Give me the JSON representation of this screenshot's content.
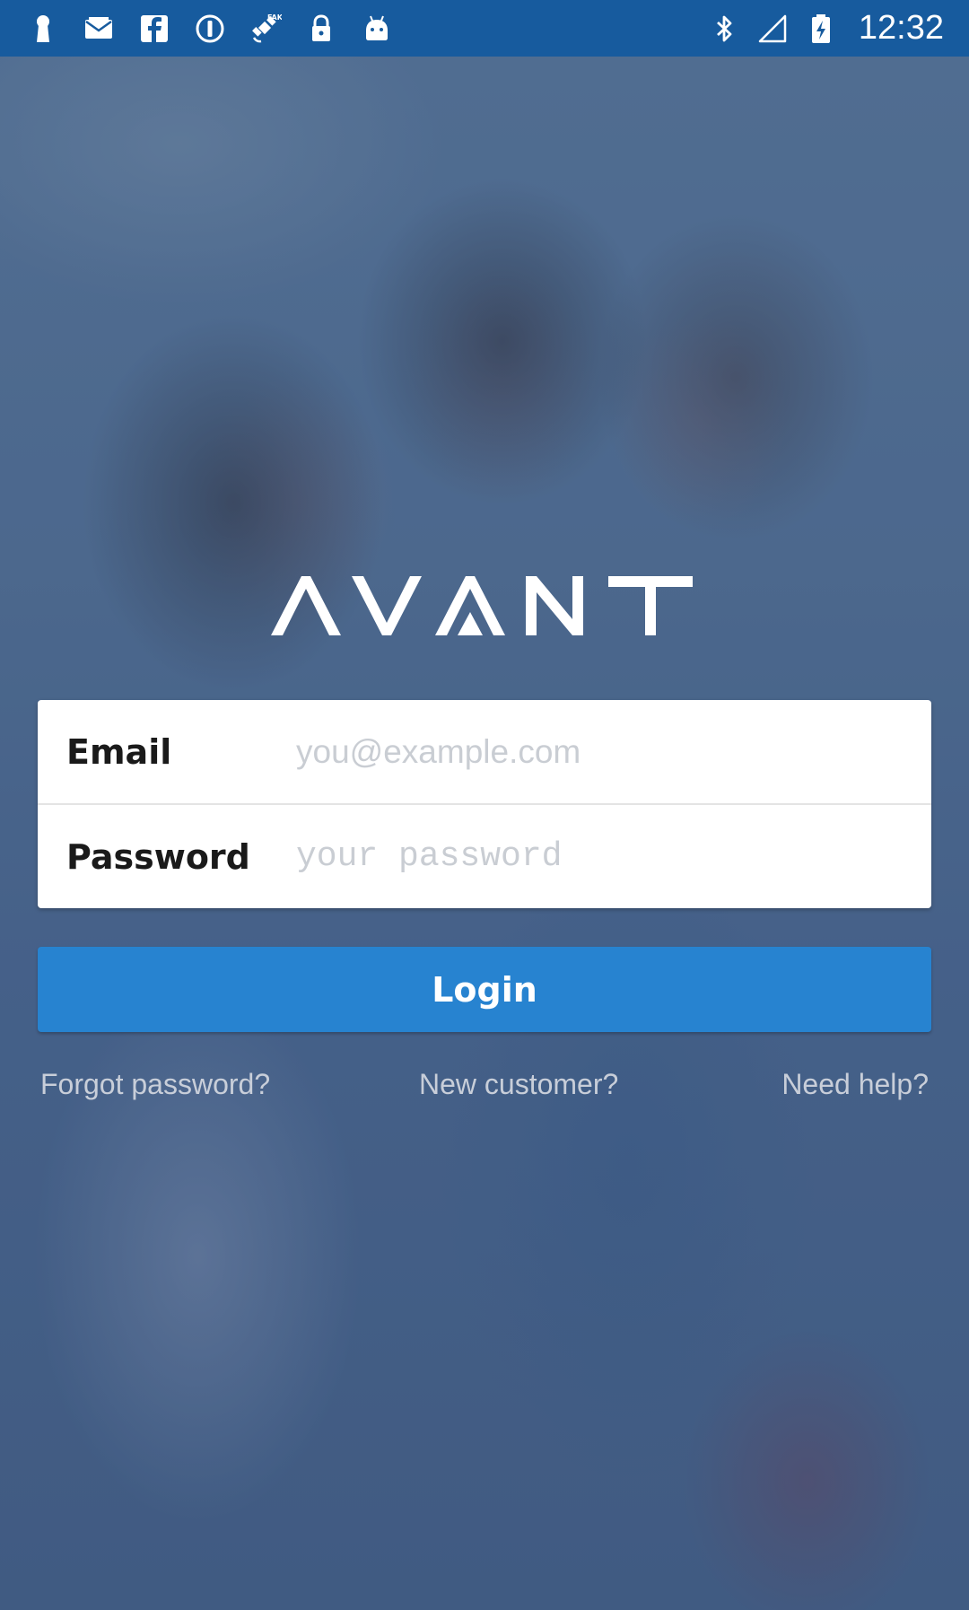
{
  "status_bar": {
    "time": "12:32",
    "left_icons": [
      "keyhole-icon",
      "mail-icon",
      "facebook-icon",
      "alert-circle-icon",
      "fake-gps-icon",
      "lock-icon",
      "android-icon"
    ],
    "right_icons": [
      "bluetooth-icon",
      "no-signal-icon",
      "battery-charging-icon"
    ]
  },
  "brand": {
    "logo_text": "AVANT"
  },
  "login_form": {
    "email_label": "Email",
    "email_placeholder": "you@example.com",
    "password_label": "Password",
    "password_placeholder": "your password"
  },
  "login_button": {
    "label": "Login"
  },
  "links": {
    "forgot_password": "Forgot password?",
    "new_customer": "New customer?",
    "need_help": "Need help?"
  },
  "colors": {
    "status_bar": "#175b9e",
    "login_button": "#2783d0",
    "card_background": "#ffffff",
    "link_text": "#c8ced9"
  }
}
